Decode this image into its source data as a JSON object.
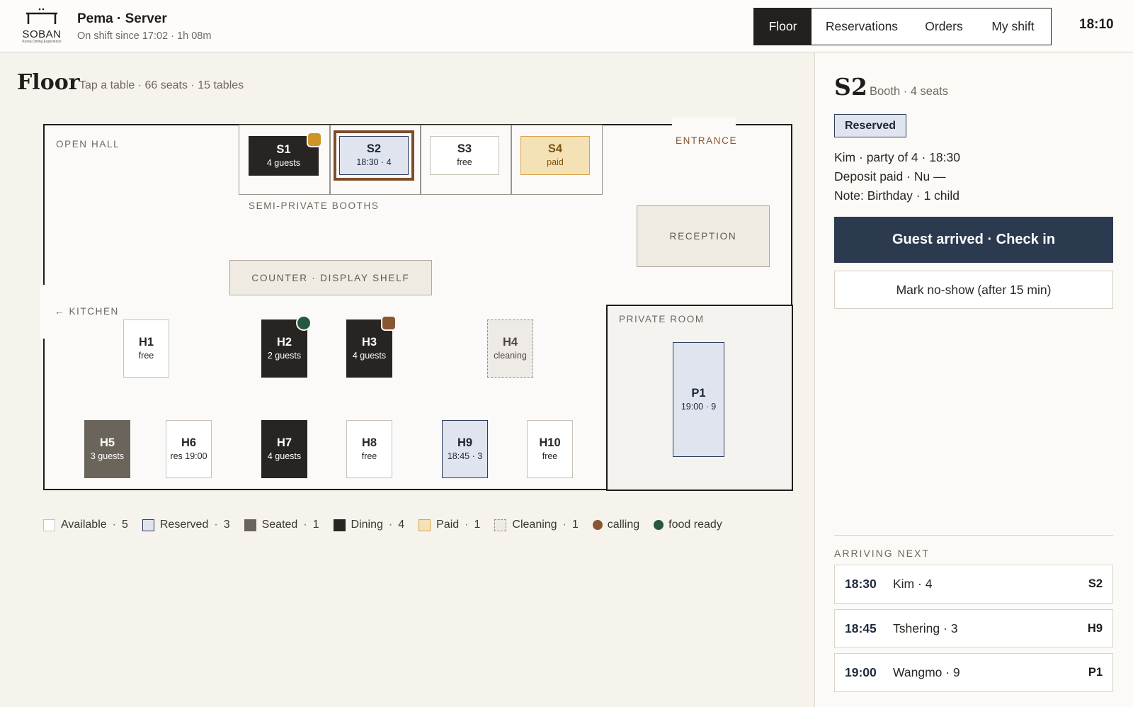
{
  "header": {
    "logo_word": "SOBAN",
    "logo_tagline": "Korea Dining Experience",
    "user": "Pema · Server",
    "shift": "On shift since 17:02 · 1h 08m",
    "tabs": [
      {
        "label": "Floor",
        "active": true
      },
      {
        "label": "Reservations",
        "active": false
      },
      {
        "label": "Orders",
        "active": false
      },
      {
        "label": "My shift",
        "active": false
      }
    ],
    "time": "18:10"
  },
  "floor": {
    "title": "Floor",
    "subtitle": "Tap a table · 66 seats · 15 tables",
    "zones": {
      "open_hall": "OPEN HALL",
      "entrance": "ENTRANCE",
      "booths": "SEMI-PRIVATE BOOTHS",
      "reception": "RECEPTION",
      "counter": "COUNTER · DISPLAY SHELF",
      "kitchen": "← KITCHEN",
      "private_room": "PRIVATE ROOM"
    },
    "tables": {
      "S1": {
        "id": "S1",
        "info": "4 guests",
        "status": "dining",
        "flag": "calling"
      },
      "S2": {
        "id": "S2",
        "info": "18:30 · 4",
        "status": "reserved",
        "selected": true
      },
      "S3": {
        "id": "S3",
        "info": "free",
        "status": "available"
      },
      "S4": {
        "id": "S4",
        "info": "paid",
        "status": "paid"
      },
      "H1": {
        "id": "H1",
        "info": "free",
        "status": "available"
      },
      "H2": {
        "id": "H2",
        "info": "2 guests",
        "status": "dining",
        "flag": "food ready"
      },
      "H3": {
        "id": "H3",
        "info": "4 guests",
        "status": "dining",
        "flag": "calling"
      },
      "H4": {
        "id": "H4",
        "info": "cleaning",
        "status": "cleaning"
      },
      "H5": {
        "id": "H5",
        "info": "3 guests",
        "status": "seated"
      },
      "H6": {
        "id": "H6",
        "info": "res 19:00",
        "status": "available"
      },
      "H7": {
        "id": "H7",
        "info": "4 guests",
        "status": "dining"
      },
      "H8": {
        "id": "H8",
        "info": "free",
        "status": "available"
      },
      "H9": {
        "id": "H9",
        "info": "18:45 · 3",
        "status": "reserved"
      },
      "H10": {
        "id": "H10",
        "info": "free",
        "status": "available"
      },
      "P1": {
        "id": "P1",
        "info": "19:00 · 9",
        "status": "reserved"
      }
    }
  },
  "legend": [
    {
      "label": "Available",
      "count": "5"
    },
    {
      "label": "Reserved",
      "count": "3"
    },
    {
      "label": "Seated",
      "count": "1"
    },
    {
      "label": "Dining",
      "count": "4"
    },
    {
      "label": "Paid",
      "count": "1"
    },
    {
      "label": "Cleaning",
      "count": "1"
    },
    {
      "label": "calling"
    },
    {
      "label": "food ready"
    }
  ],
  "colors": {
    "dining": "#272421",
    "seated": "#6b645b",
    "reserved": "#dfe4ee",
    "paid": "#f5e1b6",
    "calling": "#8a5533",
    "calling_booth": "#cd9428",
    "food_ready": "#27583f",
    "primary_button": "#2c3a50"
  },
  "detail": {
    "table": "S2",
    "type": "Booth · 4 seats",
    "status": "Reserved",
    "lines": [
      "Kim · party of 4 · 18:30",
      "Deposit paid · Nu —",
      "Note: Birthday · 1 child"
    ],
    "primary_action": "Guest arrived · Check in",
    "secondary_action": "Mark no-show (after 15 min)",
    "arriving_title": "ARRIVING NEXT",
    "arriving": [
      {
        "time": "18:30",
        "name": "Kim · 4",
        "table": "S2"
      },
      {
        "time": "18:45",
        "name": "Tshering · 3",
        "table": "H9"
      },
      {
        "time": "19:00",
        "name": "Wangmo · 9",
        "table": "P1"
      }
    ]
  }
}
